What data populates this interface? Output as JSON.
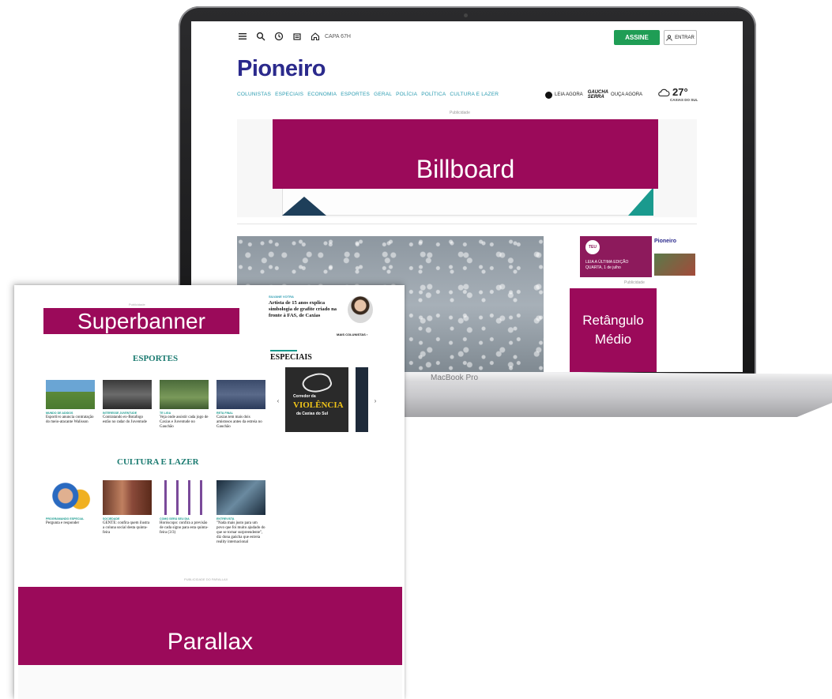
{
  "desktop": {
    "capa_label": "CAPA 67H",
    "assine_label": "ASSINE",
    "entrar_label": "ENTRAR",
    "logo": "Pioneiro",
    "nav": [
      "COLUNISTAS",
      "ESPECIAIS",
      "ECONOMIA",
      "ESPORTES",
      "GERAL",
      "POLÍCIA",
      "POLÍTICA",
      "CULTURA E LAZER"
    ],
    "leia_agora": "LEIA AGORA",
    "gaucha_top": "GAUCHA",
    "gaucha_bottom": "SERRA",
    "ouca_agora": "OUÇA AGORA",
    "temperature": "27°",
    "city": "CAXIAS DO SUL",
    "publicidade": "Publicidade",
    "billboard_label": "Billboard",
    "promo": {
      "circle": "TEU",
      "logo": "Pioneiro",
      "line1": "LEIA A ÚLTIMA EDIÇÃO",
      "line2": "QUARTA, 1 de julho"
    },
    "retangulo_label": "Retângulo\nMédio",
    "brand": "MacBook Pro"
  },
  "mobile": {
    "superbanner_label": "Superbanner",
    "columnist": {
      "kicker": "SILVANE VOTRA",
      "title": "Artista de 15 anos explica simbologia de grafite criado na fronte à FAS, de Caxias",
      "more": "MAIS COLUNISTAS"
    },
    "esportes_title": "ESPORTES",
    "especiais_title": "ESPECIAIS",
    "especiais_card": {
      "line1": "Corredor da",
      "line2": "VIOLÊNCIA",
      "line3": "da Caxias do Sul"
    },
    "esportes_cards": [
      {
        "kicker": "MUNDO DE ADIDOS",
        "title": "Esportivo anuncia contratação do meio-atacante Walisson"
      },
      {
        "kicker": "INTERESSE JUVENTUDE",
        "title": "Contratando ex-Botafogo estão no radar do Juventude"
      },
      {
        "kicker": "TE LIGA",
        "title": "Veja onde assistir cada jogo de Caxias e Juventude no Gauchão"
      },
      {
        "kicker": "RETA FINAL",
        "title": "Caxias tem mais dois amistosos antes da estreia no Gauchão"
      }
    ],
    "cultura_title": "CULTURA E LAZER",
    "cultura_cards": [
      {
        "kicker": "PROGRAMANDO ESPECIAL",
        "title": "Pergunta e responder"
      },
      {
        "kicker": "SOCIEDADE",
        "title": "GENTE: confira quem ilustra a coluna social desta quinta-feira"
      },
      {
        "kicker": "COMO SERÁ SEU DIA",
        "title": "Horóscopo: confira a previsão de cada signo para esta quinta-feira (3/3)"
      },
      {
        "kicker": "ENTREVISTA",
        "title": "\"Nada mais justo para um povo que foi muito ajudado do que se tornar surpreendente\", diz dona gaúcha que estreia reality internacional"
      }
    ],
    "publicidade_bottom": "PUBLICIDADE DO PARALLAX",
    "parallax_label": "Parallax",
    "arrow_left": "‹",
    "arrow_right": "›"
  },
  "colors": {
    "ad_magenta": "#9b0a5a",
    "logo_blue": "#2b2a8c",
    "nav_teal": "#2a9bb0",
    "assine_green": "#1f9d55",
    "section_teal": "#1a7a70"
  }
}
